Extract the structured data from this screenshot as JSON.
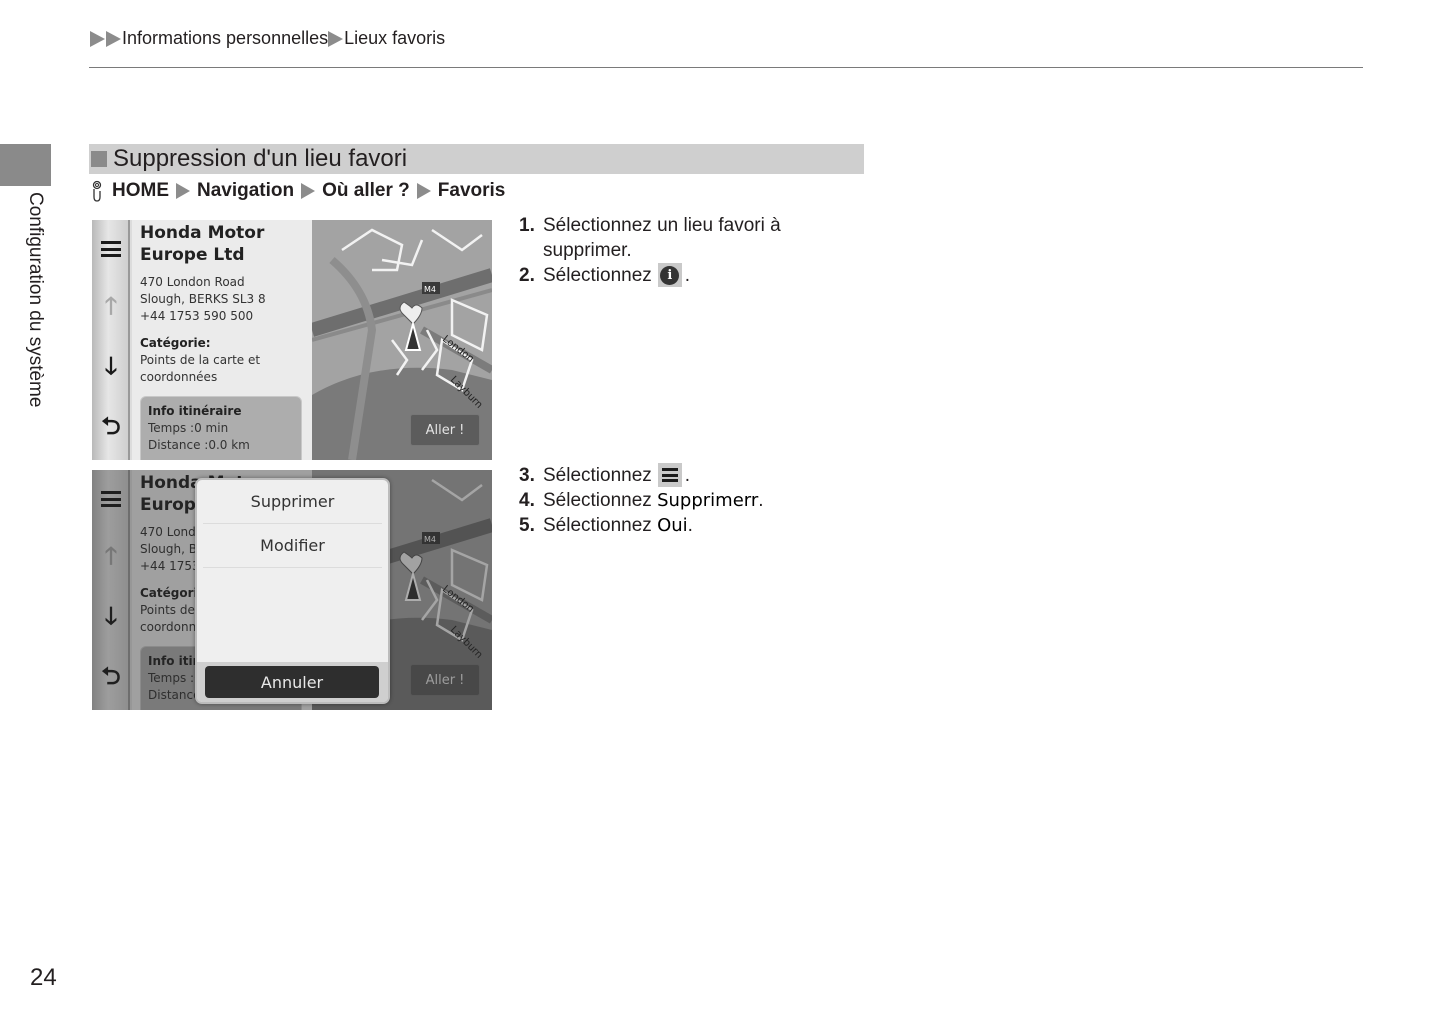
{
  "header": {
    "breadcrumb": [
      "Informations personnelles",
      "Lieux favoris"
    ]
  },
  "side_tab": {
    "label": "Configuration du système"
  },
  "section": {
    "title": "Suppression d'un lieu favori",
    "path": [
      "HOME",
      "Navigation",
      "Où aller ?",
      "Favoris"
    ],
    "path_icon": "voice-command-icon"
  },
  "screen": {
    "poi_name_line1": "Honda Motor",
    "poi_name_line2": "Europe Ltd",
    "address_line1": "470 London Road",
    "address_line2": "Slough, BERKS SL3 8",
    "phone": "+44 1753 590 500",
    "category_label": "Catégorie:",
    "category_value_line1": "Points de la carte et",
    "category_value_line2": "coordonnées",
    "route_info_title": "Info itinéraire",
    "route_time": "Temps :0 min",
    "route_distance": "Distance :0.0 km",
    "go_button": "Aller !",
    "map_labels": {
      "motorway": "M4",
      "road1": "London",
      "road2": "Layburn"
    },
    "nav_icons": [
      "menu-icon",
      "arrow-up-icon",
      "arrow-down-icon",
      "back-icon"
    ]
  },
  "popup": {
    "items": [
      "Supprimer",
      "Modifier"
    ],
    "cancel": "Annuler"
  },
  "steps_group1": [
    {
      "num": "1.",
      "text": "Sélectionnez un lieu favori à supprimer."
    },
    {
      "num": "2.",
      "text": "Sélectionnez",
      "icon": "info-icon",
      "after": "."
    }
  ],
  "steps_group2": [
    {
      "num": "3.",
      "text": "Sélectionnez",
      "icon": "menu-icon",
      "after": "."
    },
    {
      "num": "4.",
      "text": "Sélectionnez",
      "bold": "Supprimerr",
      "after": "."
    },
    {
      "num": "5.",
      "text": "Sélectionnez",
      "bold": "Oui",
      "after": "."
    }
  ],
  "page_number": "24"
}
